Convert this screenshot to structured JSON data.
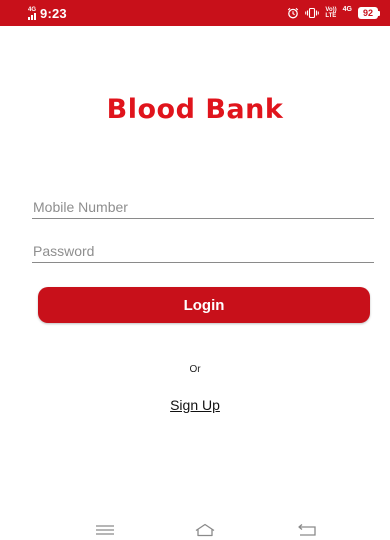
{
  "status_bar": {
    "network_left": "4G",
    "time": "9:23",
    "volte_top": "Vo))",
    "volte_bottom": "LTE",
    "network_right": "4G",
    "battery": "92",
    "color": "#c8101a"
  },
  "app": {
    "title": "Blood Bank",
    "title_color": "#e0141c"
  },
  "form": {
    "mobile_placeholder": "Mobile Number",
    "mobile_value": "",
    "password_placeholder": "Password",
    "password_value": "",
    "login_label": "Login",
    "or_label": "Or",
    "signup_label": "Sign Up"
  },
  "nav_bar": {
    "icons": [
      "menu-icon",
      "home-icon",
      "back-icon"
    ]
  }
}
